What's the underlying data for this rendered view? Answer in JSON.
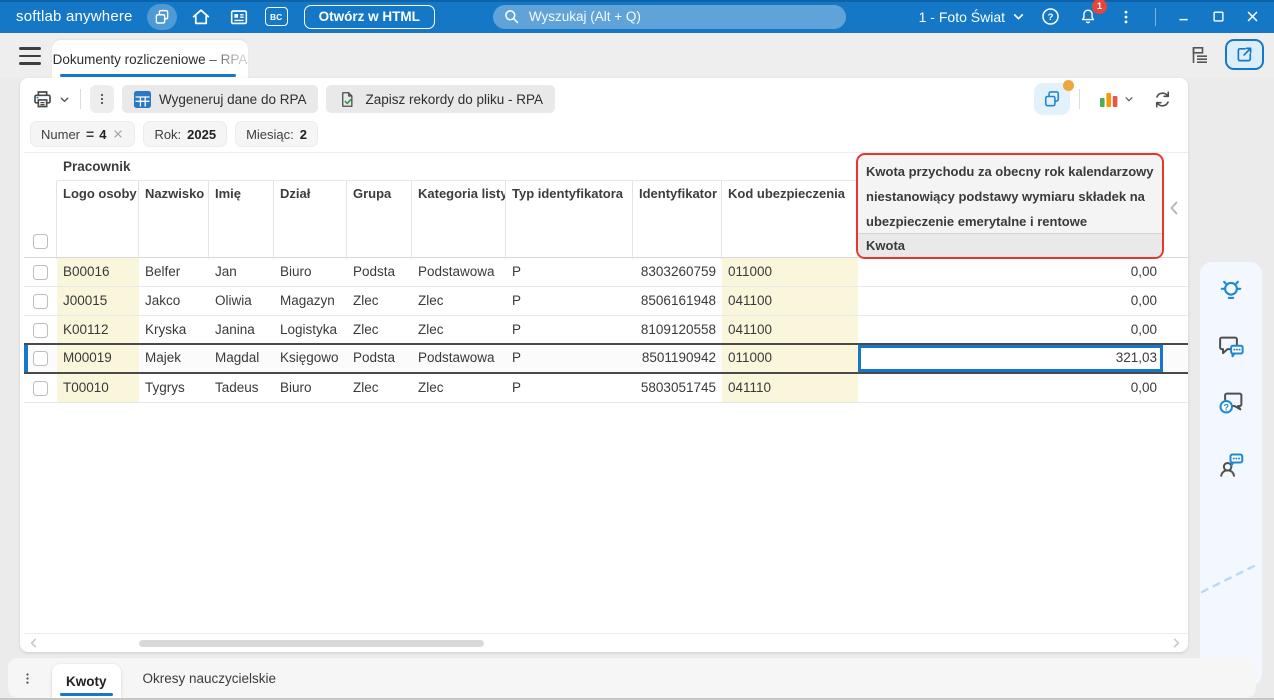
{
  "titlebar": {
    "brand": "softlab anywhere",
    "bc_label": "BC",
    "open_html": "Otwórz w HTML",
    "search_placeholder": "Wyszukaj (Alt + Q)",
    "company": "1 - Foto Świat",
    "notifications": "1"
  },
  "tab": {
    "title": "Dokumenty rozliczeniowe – RPA"
  },
  "toolbar": {
    "generate": "Wygeneruj dane do RPA",
    "save": "Zapisz rekordy do pliku - RPA"
  },
  "filters": {
    "numer_label": "Numer",
    "numer_op": "=",
    "numer_value": "4",
    "rok_label": "Rok:",
    "rok_value": "2025",
    "miesiac_label": "Miesiąc:",
    "miesiac_value": "2"
  },
  "table": {
    "group": "Pracownik",
    "columns": {
      "logo": "Logo osoby",
      "nazwisko": "Nazwisko",
      "imie": "Imię",
      "dzial": "Dział",
      "grupa": "Grupa",
      "kategoria": "Kategoria listy",
      "typ": "Typ identyfikatora",
      "identyfikator": "Identyfikator",
      "kod": "Kod ubezpieczenia"
    },
    "highlight": {
      "line1": "Kwota przychodu za obecny rok kalendarzowy",
      "line2": "niestanowiący podstawy wymiaru składek na",
      "line3": "ubezpieczenie emerytalne i rentowe",
      "sub": "Kwota"
    },
    "rows": [
      {
        "logo": "B00016",
        "nazwisko": "Belfer",
        "imie": "Jan",
        "dzial": "Biuro",
        "grupa": "Podsta",
        "kategoria": "Podstawowa",
        "typ": "P",
        "identyfikator": "8303260759",
        "kod": "011000",
        "kwota": "0,00"
      },
      {
        "logo": "J00015",
        "nazwisko": "Jakco",
        "imie": "Oliwia",
        "dzial": "Magazyn",
        "grupa": "Zlec",
        "kategoria": "Zlec",
        "typ": "P",
        "identyfikator": "8506161948",
        "kod": "041100",
        "kwota": "0,00"
      },
      {
        "logo": "K00112",
        "nazwisko": "Kryska",
        "imie": "Janina",
        "dzial": "Logistyka",
        "grupa": "Zlec",
        "kategoria": "Zlec",
        "typ": "P",
        "identyfikator": "8109120558",
        "kod": "041100",
        "kwota": "0,00"
      },
      {
        "logo": "M00019",
        "nazwisko": "Majek",
        "imie": "Magdal",
        "dzial": "Księgowo",
        "grupa": "Podsta",
        "kategoria": "Podstawowa",
        "typ": "P",
        "identyfikator": "8501190942",
        "kod": "011000",
        "kwota": "321,03"
      },
      {
        "logo": "T00010",
        "nazwisko": "Tygrys",
        "imie": "Tadeus",
        "dzial": "Biuro",
        "grupa": "Zlec",
        "kategoria": "Zlec",
        "typ": "P",
        "identyfikator": "5803051745",
        "kod": "041110",
        "kwota": "0,00"
      }
    ]
  },
  "bottom": {
    "tab_active": "Kwoty",
    "tab_other": "Okresy nauczycielskie"
  },
  "icons": {
    "titlebar": [
      "workspace-layers-icon",
      "home-icon",
      "news-icon",
      "bc-icon",
      "search-icon",
      "chevron-down-icon",
      "help-icon",
      "bell-icon",
      "kebab-icon",
      "minimize-icon",
      "maximize-icon",
      "close-icon"
    ],
    "toolbar": [
      "printer-icon",
      "kebab-icon",
      "table-generate-icon",
      "file-check-icon",
      "layers-icon",
      "bar-chart-icon",
      "refresh-icon"
    ],
    "assist": [
      "lightbulb-icon",
      "feedback-chat-icon",
      "help-chat-icon",
      "community-icon"
    ]
  },
  "colors": {
    "accent_blue": "#1478c6",
    "selection_blue": "#1678c8",
    "highlight_red": "#e8352e",
    "cell_yellow": "#faf6dc",
    "badge_red": "#e8453c",
    "badge_orange": "#eda73e"
  }
}
